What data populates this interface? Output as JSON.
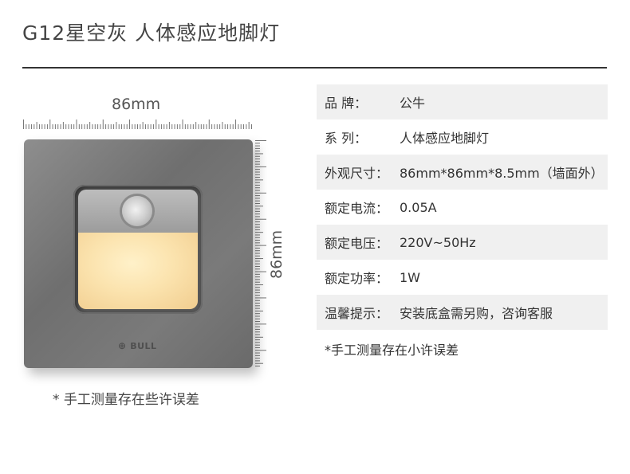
{
  "header": {
    "title": "G12星空灰  人体感应地脚灯"
  },
  "product": {
    "width_label": "86mm",
    "height_label": "86mm",
    "logo_text": "BULL",
    "note": "* 手工测量存在些许误差"
  },
  "specs": [
    {
      "label": "品    牌：",
      "value": "公牛"
    },
    {
      "label": "系    列：",
      "value": "人体感应地脚灯"
    },
    {
      "label": "外观尺寸：",
      "value": "86mm*86mm*8.5mm（墙面外）"
    },
    {
      "label": "额定电流：",
      "value": "0.05A"
    },
    {
      "label": "额定电压：",
      "value": "220V~50Hz"
    },
    {
      "label": "额定功率：",
      "value": "1W"
    },
    {
      "label": "温馨提示：",
      "value": "安装底盒需另购，咨询客服"
    }
  ],
  "spec_note": "*手工测量存在小许误差",
  "colors": {
    "plate": "#7a7a7a",
    "light": "#fbe3ae",
    "rule": "#333333",
    "row_shade": "#f0f0f0"
  }
}
